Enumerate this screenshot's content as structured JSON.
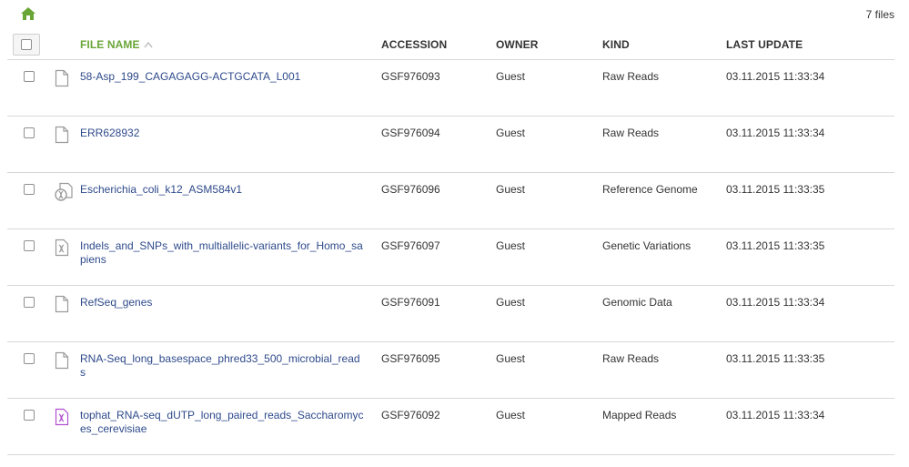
{
  "toolbar": {
    "home_icon": "home-icon",
    "file_count": "7 files"
  },
  "colors": {
    "accent": "#6aa637",
    "link": "#2e4a8b",
    "mapped_icon": "#b050d0"
  },
  "columns": {
    "file_name": "FILE NAME",
    "accession": "ACCESSION",
    "owner": "OWNER",
    "kind": "KIND",
    "last_update": "LAST UPDATE",
    "sort_icon": "sort-ascending-icon"
  },
  "rows": [
    {
      "name": "58-Asp_199_CAGAGAGG-ACTGCATA_L001",
      "accession": "GSF976093",
      "owner": "Guest",
      "kind": "Raw Reads",
      "last_update": "03.11.2015 11:33:34",
      "icon": "document-icon"
    },
    {
      "name": "ERR628932",
      "accession": "GSF976094",
      "owner": "Guest",
      "kind": "Raw Reads",
      "last_update": "03.11.2015 11:33:34",
      "icon": "document-icon"
    },
    {
      "name": "Escherichia_coli_k12_ASM584v1",
      "accession": "GSF976096",
      "owner": "Guest",
      "kind": "Reference Genome",
      "last_update": "03.11.2015 11:33:35",
      "icon": "reference-genome-icon"
    },
    {
      "name": "Indels_and_SNPs_with_multiallelic-variants_for_Homo_sapiens",
      "accession": "GSF976097",
      "owner": "Guest",
      "kind": "Genetic Variations",
      "last_update": "03.11.2015 11:33:35",
      "icon": "genetic-variation-icon"
    },
    {
      "name": "RefSeq_genes",
      "accession": "GSF976091",
      "owner": "Guest",
      "kind": "Genomic Data",
      "last_update": "03.11.2015 11:33:34",
      "icon": "document-icon"
    },
    {
      "name": "RNA-Seq_long_basespace_phred33_500_microbial_reads",
      "accession": "GSF976095",
      "owner": "Guest",
      "kind": "Raw Reads",
      "last_update": "03.11.2015 11:33:35",
      "icon": "document-icon"
    },
    {
      "name": "tophat_RNA-seq_dUTP_long_paired_reads_Saccharomyces_cerevisiae",
      "accession": "GSF976092",
      "owner": "Guest",
      "kind": "Mapped Reads",
      "last_update": "03.11.2015 11:33:34",
      "icon": "mapped-reads-icon"
    }
  ]
}
